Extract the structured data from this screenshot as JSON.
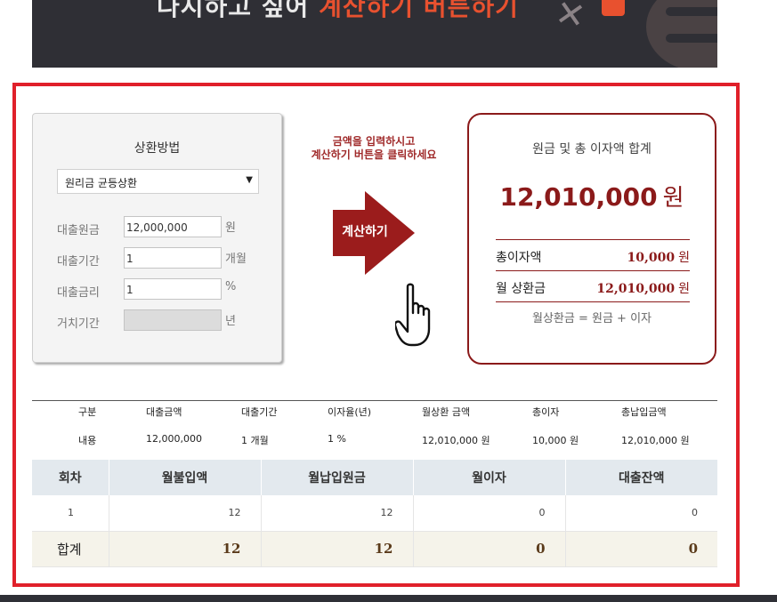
{
  "banner": {
    "prefix": "다시하고 싶어 ",
    "highlight": "계산하기 버튼하기"
  },
  "input": {
    "title": "상환방법",
    "method": "원리금 균등상환",
    "fields": [
      {
        "label": "대출원금",
        "value": "12,000,000",
        "unit": "원"
      },
      {
        "label": "대출기간",
        "value": "1",
        "unit": "개월"
      },
      {
        "label": "대출금리",
        "value": "1",
        "unit": "%"
      },
      {
        "label": "거치기간",
        "value": "",
        "unit": "년"
      }
    ]
  },
  "guide": {
    "line1": "금액을 입력하시고",
    "line2": "계산하기 버튼을 클릭하세요",
    "button": "계산하기"
  },
  "result": {
    "title": "원금 및 총 이자액 합계",
    "total": "12,010,000",
    "total_unit": "원",
    "interest_label": "총이자액",
    "interest": "10,000",
    "interest_unit": "원",
    "monthly_label": "월 상환금",
    "monthly": "12,010,000",
    "monthly_unit": "원",
    "note": "월상환금 = 원금 + 이자"
  },
  "summary": {
    "headers": [
      "구분",
      "대출금액",
      "대출기간",
      "이자율(년)",
      "월상환 금액",
      "총이자",
      "총납입금액"
    ],
    "values": [
      "내용",
      "12,000,000",
      "1 개월",
      "1 %",
      "12,010,000 원",
      "10,000 원",
      "12,010,000 원"
    ]
  },
  "schedule": {
    "headers": [
      "회차",
      "월불입액",
      "월납입원금",
      "월이자",
      "대출잔액"
    ],
    "rows": [
      [
        "1",
        "12",
        "12",
        "0",
        "0"
      ]
    ],
    "total": [
      "합계",
      "12",
      "12",
      "0",
      "0"
    ]
  },
  "colors": {
    "frame": "#e0202a",
    "accent": "#8b1a1a",
    "arrow": "#9b1c1c"
  }
}
